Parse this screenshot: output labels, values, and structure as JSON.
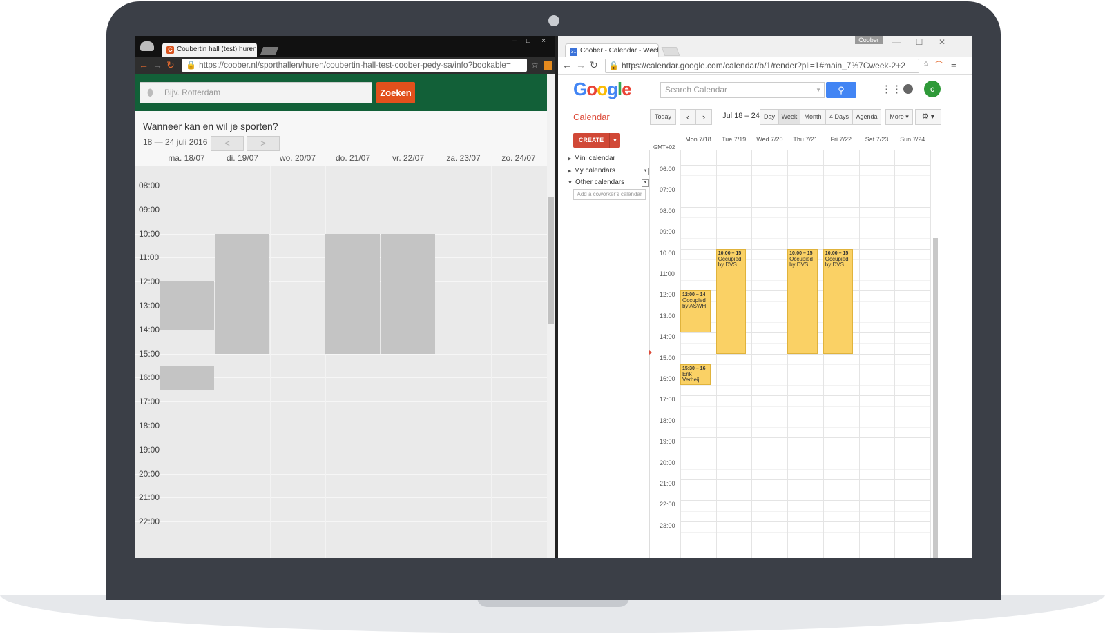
{
  "left_browser": {
    "tab_title": "Coubertin hall (test) huren",
    "tab_close": "×",
    "window_controls": [
      "‒",
      "□",
      "×"
    ],
    "url": "https://coober.nl/sporthallen/huren/coubertin-hall-test-coober-pedy-sa/info?bookable=",
    "search_placeholder": "Bijv. Rotterdam",
    "search_button": "Zoeken",
    "question": "Wanneer kan en wil je sporten?",
    "date_range": "18 — 24 juli 2016",
    "prev": "<",
    "next": ">",
    "days": [
      "ma. 18/07",
      "di. 19/07",
      "wo. 20/07",
      "do. 21/07",
      "vr. 22/07",
      "za. 23/07",
      "zo. 24/07"
    ],
    "times": [
      "08:00",
      "09:00",
      "10:00",
      "11:00",
      "12:00",
      "13:00",
      "14:00",
      "15:00",
      "16:00",
      "17:00",
      "18:00",
      "19:00",
      "20:00",
      "21:00",
      "22:00"
    ]
  },
  "right_browser": {
    "tab_title": "Coober - Calendar - Week",
    "tab_close": "×",
    "favicon": "31",
    "profile": "Coober",
    "window_controls": [
      "—",
      "☐",
      "✕"
    ],
    "url": "https://calendar.google.com/calendar/b/1/render?pli=1#main_7%7Cweek-2+2",
    "logo_letters": [
      "G",
      "o",
      "o",
      "g",
      "l",
      "e"
    ],
    "search_placeholder": "Search Calendar",
    "avatar_letter": "c",
    "calendar_label": "Calendar",
    "buttons": {
      "today": "Today",
      "prev": "‹",
      "next": "›",
      "day": "Day",
      "week": "Week",
      "month": "Month",
      "four_days": "4 Days",
      "agenda": "Agenda",
      "more": "More ▾",
      "settings": "⚙ ▾"
    },
    "date_range": "Jul 18 – 24",
    "create": "CREATE",
    "create_dd": "▼",
    "sidebar": {
      "mini_calendar": "Mini calendar",
      "my_calendars": "My calendars",
      "other_calendars": "Other calendars",
      "add_coworker": "Add a coworker's calendar"
    },
    "timezone": "GMT+02",
    "days": [
      "Mon 7/18",
      "Tue 7/19",
      "Wed 7/20",
      "Thu 7/21",
      "Fri 7/22",
      "Sat 7/23",
      "Sun 7/24"
    ],
    "times": [
      "06:00",
      "07:00",
      "08:00",
      "09:00",
      "10:00",
      "11:00",
      "12:00",
      "13:00",
      "14:00",
      "15:00",
      "16:00",
      "17:00",
      "18:00",
      "19:00",
      "20:00",
      "21:00",
      "22:00",
      "23:00"
    ],
    "events": [
      {
        "time": "12:00 – 14",
        "title": "Occupied by ASWH"
      },
      {
        "time": "10:00 – 15",
        "title": "Occupied by DVS"
      },
      {
        "time": "10:00 – 15",
        "title": "Occupied by DVS"
      },
      {
        "time": "10:00 – 15",
        "title": "Occupied by DVS"
      },
      {
        "time": "15:30 – 16",
        "title": "Erik Verheij"
      }
    ]
  },
  "colors": {
    "coober_green": "#126038",
    "coober_orange": "#e2501c",
    "event_yellow": "#fad165",
    "google_red": "#dd4b39",
    "google_blue": "#4285f4"
  }
}
